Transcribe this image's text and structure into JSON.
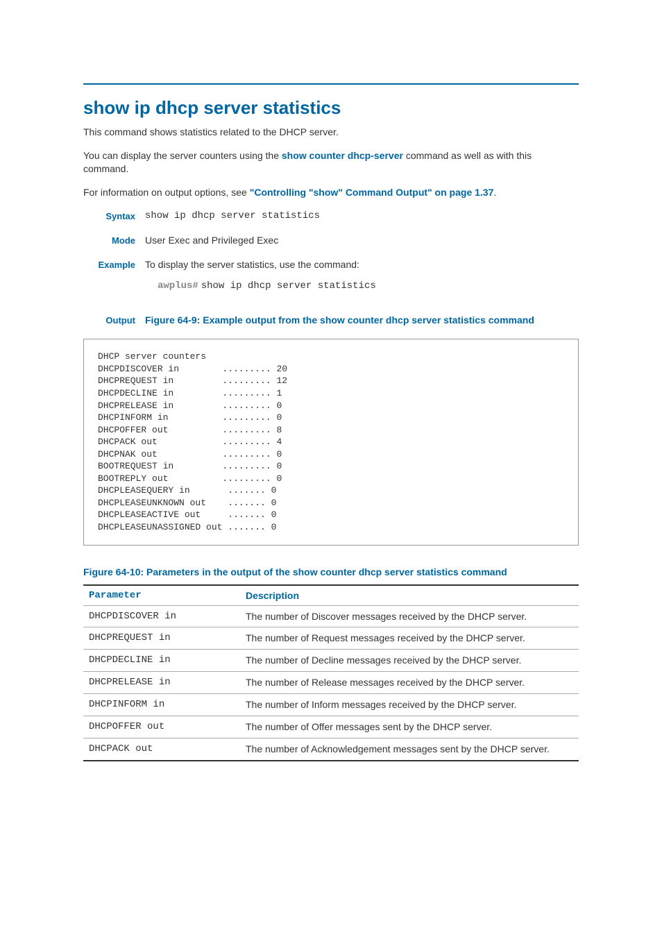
{
  "heading": "show ip dhcp server statistics",
  "intro_p1": "This command shows statistics related to the DHCP server.",
  "intro_p2_pre": "You can display the server counters using the ",
  "intro_p2_link": "show counter dhcp-server",
  "intro_p2_post": " command as well as with this command.",
  "intro_p3_pre": "For information on output options, see ",
  "intro_p3_link": "\"Controlling \"show\" Command Output\" on page 1.37",
  "intro_p3_post": ".",
  "syntax_label": "Syntax",
  "syntax_value": "show ip dhcp server statistics",
  "mode_label": "Mode",
  "mode_value": "User Exec and Privileged Exec",
  "example_label": "Example",
  "example_text": "To display the server statistics, use the command:",
  "example_prompt": "awplus#",
  "example_cmd": "show ip dhcp server statistics",
  "output_label": "Output",
  "fig1_caption": "Figure 64-9: Example output from the show counter dhcp server statistics command",
  "output_block": "DHCP server counters\nDHCPDISCOVER in        ......... 20\nDHCPREQUEST in         ......... 12\nDHCPDECLINE in         ......... 1\nDHCPRELEASE in         ......... 0\nDHCPINFORM in          ......... 0\nDHCPOFFER out          ......... 8\nDHCPACK out            ......... 4\nDHCPNAK out            ......... 0\nBOOTREQUEST in         ......... 0\nBOOTREPLY out          ......... 0\nDHCPLEASEQUERY in       ....... 0\nDHCPLEASEUNKNOWN out    ....... 0\nDHCPLEASEACTIVE out     ....... 0\nDHCPLEASEUNASSIGNED out ....... 0",
  "fig2_caption": "Figure 64-10: Parameters in the output of the show counter dhcp server statistics command",
  "table": {
    "head_param": "Parameter",
    "head_desc": "Description",
    "rows": [
      {
        "param": "DHCPDISCOVER in",
        "desc": "The number of Discover messages received by the DHCP server."
      },
      {
        "param": "DHCPREQUEST in",
        "desc": "The number of Request messages received by the DHCP server."
      },
      {
        "param": "DHCPDECLINE in",
        "desc": "The number of Decline messages received by the DHCP server."
      },
      {
        "param": "DHCPRELEASE in",
        "desc": "The number of Release messages received by the DHCP server."
      },
      {
        "param": "DHCPINFORM in",
        "desc": "The number of Inform messages received by the DHCP server."
      },
      {
        "param": "DHCPOFFER out",
        "desc": "The number of Offer messages sent by the DHCP server."
      },
      {
        "param": "DHCPACK out",
        "desc": "The number of Acknowledgement messages sent by the DHCP server."
      }
    ]
  },
  "chart_data": {
    "type": "table",
    "title": "DHCP server counters",
    "rows": [
      {
        "counter": "DHCPDISCOVER in",
        "value": 20
      },
      {
        "counter": "DHCPREQUEST in",
        "value": 12
      },
      {
        "counter": "DHCPDECLINE in",
        "value": 1
      },
      {
        "counter": "DHCPRELEASE in",
        "value": 0
      },
      {
        "counter": "DHCPINFORM in",
        "value": 0
      },
      {
        "counter": "DHCPOFFER out",
        "value": 8
      },
      {
        "counter": "DHCPACK out",
        "value": 4
      },
      {
        "counter": "DHCPNAK out",
        "value": 0
      },
      {
        "counter": "BOOTREQUEST in",
        "value": 0
      },
      {
        "counter": "BOOTREPLY out",
        "value": 0
      },
      {
        "counter": "DHCPLEASEQUERY in",
        "value": 0
      },
      {
        "counter": "DHCPLEASEUNKNOWN out",
        "value": 0
      },
      {
        "counter": "DHCPLEASEACTIVE out",
        "value": 0
      },
      {
        "counter": "DHCPLEASEUNASSIGNED out",
        "value": 0
      }
    ]
  }
}
